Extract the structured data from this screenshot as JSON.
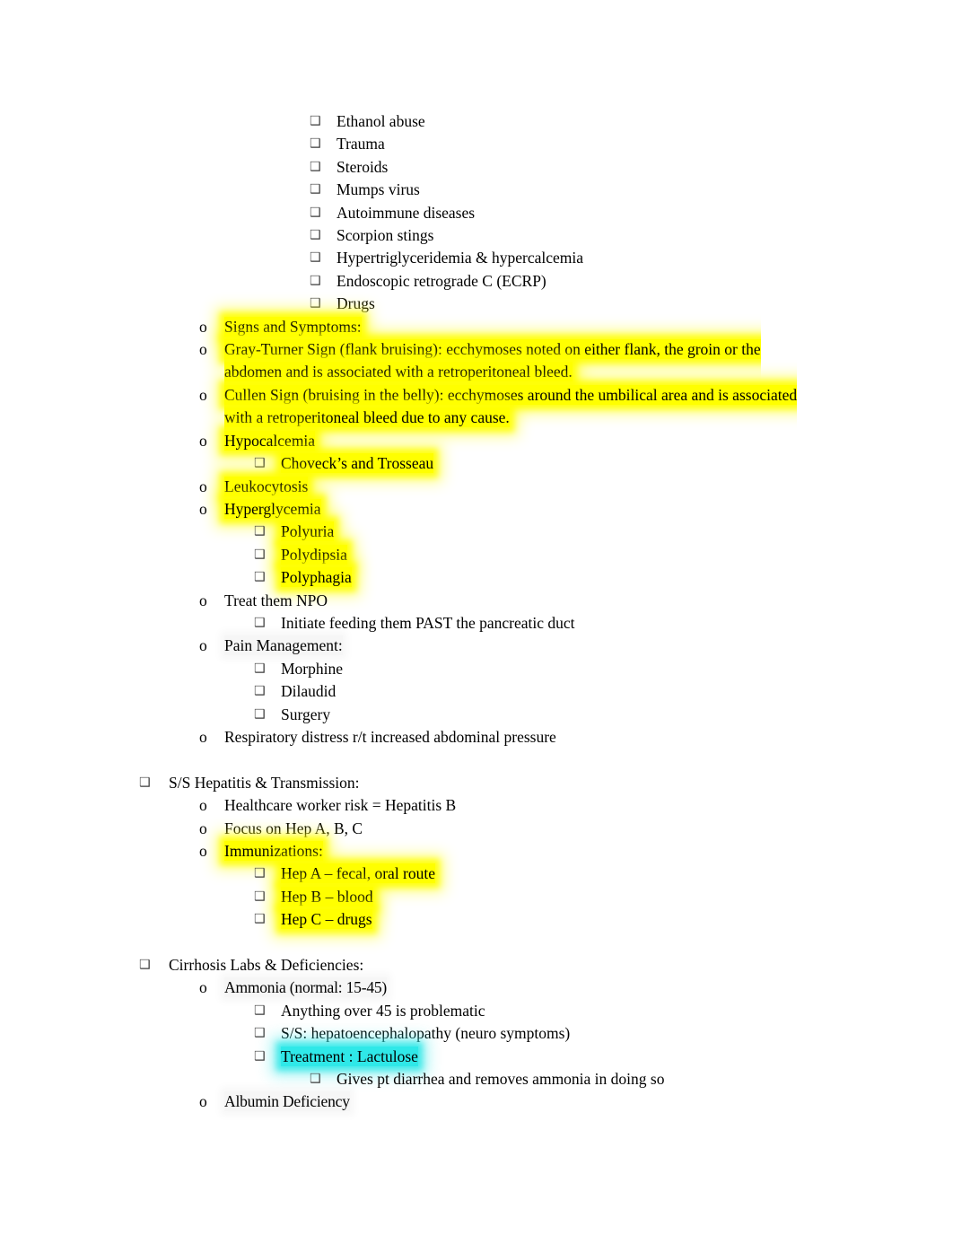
{
  "document": {
    "title": "Nursing Study Notes — Pancreatitis, Hepatitis, Cirrhosis",
    "bullet_glyph": "❑",
    "circle_glyph": "o",
    "colors": {
      "highlight_yellow": "#FFFF00",
      "highlight_cyan": "#2FE8E8",
      "text": "#000000",
      "background": "#FFFFFF"
    }
  },
  "blocks": [
    {
      "id": "pancreatitis_causes",
      "items": [
        {
          "level": 4,
          "marker": "box",
          "text": "Ethanol abuse",
          "highlight": "none"
        },
        {
          "level": 4,
          "marker": "box",
          "text": "Trauma",
          "highlight": "none"
        },
        {
          "level": 4,
          "marker": "box",
          "text": "Steroids",
          "highlight": "none"
        },
        {
          "level": 4,
          "marker": "box",
          "text": "Mumps virus",
          "highlight": "none"
        },
        {
          "level": 4,
          "marker": "box",
          "text": "Autoimmune diseases",
          "highlight": "none"
        },
        {
          "level": 4,
          "marker": "box",
          "text": "Scorpion stings",
          "highlight": "none"
        },
        {
          "level": 4,
          "marker": "box",
          "text": "Hypertriglyceridemia & hypercalcemia",
          "highlight": "none"
        },
        {
          "level": 4,
          "marker": "box",
          "text": "Endoscopic retrograde C (ECRP)",
          "highlight": "none"
        },
        {
          "level": 4,
          "marker": "box",
          "text": "Drugs",
          "highlight": "none"
        },
        {
          "level": 2,
          "marker": "o",
          "text": "Signs and Symptoms:",
          "highlight": "yellow"
        },
        {
          "level": 2,
          "marker": "o",
          "text": "Gray-Turner Sign (flank bruising): ecchymoses noted on either flank, the groin or the abdomen and is associated with a retroperitoneal bleed.",
          "highlight": "yellow",
          "wrap": true
        },
        {
          "level": 2,
          "marker": "o",
          "text": "Cullen Sign (bruising in the belly): ecchymoses around the umbilical area and is associated with a retroperitoneal bleed due to any cause.",
          "highlight": "yellow",
          "wrap": true
        },
        {
          "level": 2,
          "marker": "o",
          "text": "Hypocalcemia",
          "highlight": "yellow"
        },
        {
          "level": 3,
          "marker": "box",
          "text": "Choveck’s and Trosseau",
          "highlight": "yellow"
        },
        {
          "level": 2,
          "marker": "o",
          "text": "Leukocytosis",
          "highlight": "yellow"
        },
        {
          "level": 2,
          "marker": "o",
          "text": "Hyperglycemia",
          "highlight": "yellow"
        },
        {
          "level": 3,
          "marker": "box",
          "text": "Polyuria",
          "highlight": "yellow"
        },
        {
          "level": 3,
          "marker": "box",
          "text": "Polydipsia",
          "highlight": "yellow"
        },
        {
          "level": 3,
          "marker": "box",
          "text": "Polyphagia",
          "highlight": "yellow"
        },
        {
          "level": 2,
          "marker": "o",
          "text": "Treat them NPO",
          "highlight": "none"
        },
        {
          "level": 3,
          "marker": "box",
          "text": "Initiate feeding them PAST the pancreatic duct",
          "highlight": "none"
        },
        {
          "level": 2,
          "marker": "o",
          "text": "Pain Management:",
          "highlight": "gray"
        },
        {
          "level": 3,
          "marker": "box",
          "text": "Morphine",
          "highlight": "none"
        },
        {
          "level": 3,
          "marker": "box",
          "text": "Dilaudid",
          "highlight": "none"
        },
        {
          "level": 3,
          "marker": "box",
          "text": "Surgery",
          "highlight": "none"
        },
        {
          "level": 2,
          "marker": "o",
          "text": "Respiratory distress r/t increased abdominal pressure",
          "highlight": "none"
        }
      ]
    },
    {
      "id": "hepatitis",
      "items": [
        {
          "level": 1,
          "marker": "box",
          "text": "S/S Hepatitis & Transmission:",
          "highlight": "none"
        },
        {
          "level": 2,
          "marker": "o",
          "text": "Healthcare worker risk = Hepatitis B",
          "highlight": "none"
        },
        {
          "level": 2,
          "marker": "o",
          "text": "Focus on Hep A, B, C",
          "highlight": "none"
        },
        {
          "level": 2,
          "marker": "o",
          "text": "Immunizations:",
          "highlight": "yellow"
        },
        {
          "level": 3,
          "marker": "box",
          "text": "Hep A – fecal, oral route",
          "highlight": "yellow"
        },
        {
          "level": 3,
          "marker": "box",
          "text": "Hep B – blood",
          "highlight": "yellow"
        },
        {
          "level": 3,
          "marker": "box",
          "text": "Hep C – drugs",
          "highlight": "yellow"
        }
      ]
    },
    {
      "id": "cirrhosis",
      "items": [
        {
          "level": 1,
          "marker": "box",
          "text": "Cirrhosis Labs & Deficiencies:",
          "highlight": "none"
        },
        {
          "level": 2,
          "marker": "o",
          "text": "Ammonia (normal: 15-45)",
          "highlight": "gray",
          "tight": true
        },
        {
          "level": 3,
          "marker": "box",
          "text": "Anything over 45 is problematic",
          "highlight": "none"
        },
        {
          "level": 3,
          "marker": "box",
          "text": "S/S: hepatoencephalopathy (neuro symptoms)",
          "highlight": "none"
        },
        {
          "level": 3,
          "marker": "box",
          "text": "Treatment : Lactulose",
          "highlight": "cyan"
        },
        {
          "level": 4,
          "marker": "box",
          "text": "Gives pt diarrhea and removes ammonia in doing so",
          "highlight": "none"
        },
        {
          "level": 2,
          "marker": "o",
          "text": "Albumin Deficiency",
          "highlight": "gray",
          "tight": true
        }
      ]
    }
  ]
}
